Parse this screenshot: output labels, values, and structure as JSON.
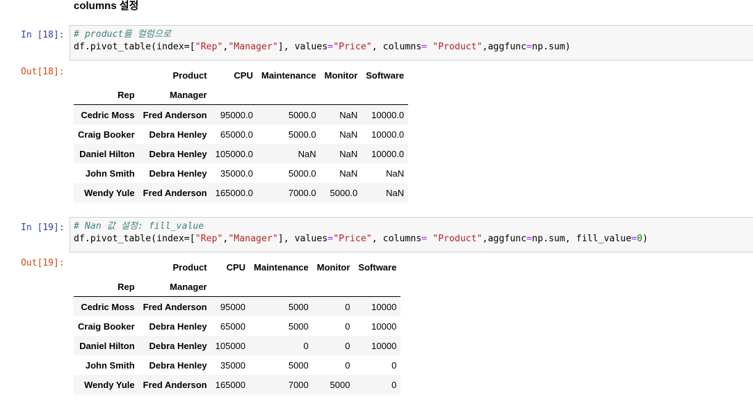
{
  "heading": "columns 설정",
  "cells": [
    {
      "in_prompt": "In [18]:",
      "out_prompt": "Out[18]:",
      "code_comment": "# product를 컬럼으로",
      "code_line2_parts": [
        "df.pivot_table(index=[",
        "\"Rep\"",
        ",",
        "\"Manager\"",
        "], values",
        "=",
        "\"Price\"",
        ", columns",
        "=",
        " ",
        "\"Product\"",
        ",aggfunc",
        "=",
        "np.sum)"
      ],
      "table": {
        "col_header_name": "Product",
        "columns": [
          "CPU",
          "Maintenance",
          "Monitor",
          "Software"
        ],
        "index_names": [
          "Rep",
          "Manager"
        ],
        "rows": [
          {
            "rep": "Cedric Moss",
            "manager": "Fred Anderson",
            "values": [
              "95000.0",
              "5000.0",
              "NaN",
              "10000.0"
            ]
          },
          {
            "rep": "Craig Booker",
            "manager": "Debra Henley",
            "values": [
              "65000.0",
              "5000.0",
              "NaN",
              "10000.0"
            ]
          },
          {
            "rep": "Daniel Hilton",
            "manager": "Debra Henley",
            "values": [
              "105000.0",
              "NaN",
              "NaN",
              "10000.0"
            ]
          },
          {
            "rep": "John Smith",
            "manager": "Debra Henley",
            "values": [
              "35000.0",
              "5000.0",
              "NaN",
              "NaN"
            ]
          },
          {
            "rep": "Wendy Yule",
            "manager": "Fred Anderson",
            "values": [
              "165000.0",
              "7000.0",
              "5000.0",
              "NaN"
            ]
          }
        ]
      }
    },
    {
      "in_prompt": "In [19]:",
      "out_prompt": "Out[19]:",
      "code_comment": "# Nan 값 설정: fill_value",
      "code_line2_parts": [
        "df.pivot_table(index=[",
        "\"Rep\"",
        ",",
        "\"Manager\"",
        "], values",
        "=",
        "\"Price\"",
        ", columns",
        "=",
        " ",
        "\"Product\"",
        ",aggfunc",
        "=",
        "np.sum, fill_value",
        "=",
        "0",
        ")"
      ],
      "table": {
        "col_header_name": "Product",
        "columns": [
          "CPU",
          "Maintenance",
          "Monitor",
          "Software"
        ],
        "index_names": [
          "Rep",
          "Manager"
        ],
        "rows": [
          {
            "rep": "Cedric Moss",
            "manager": "Fred Anderson",
            "values": [
              "95000",
              "5000",
              "0",
              "10000"
            ]
          },
          {
            "rep": "Craig Booker",
            "manager": "Debra Henley",
            "values": [
              "65000",
              "5000",
              "0",
              "10000"
            ]
          },
          {
            "rep": "Daniel Hilton",
            "manager": "Debra Henley",
            "values": [
              "105000",
              "0",
              "0",
              "10000"
            ]
          },
          {
            "rep": "John Smith",
            "manager": "Debra Henley",
            "values": [
              "35000",
              "5000",
              "0",
              "0"
            ]
          },
          {
            "rep": "Wendy Yule",
            "manager": "Fred Anderson",
            "values": [
              "165000",
              "7000",
              "5000",
              "0"
            ]
          }
        ]
      }
    }
  ]
}
